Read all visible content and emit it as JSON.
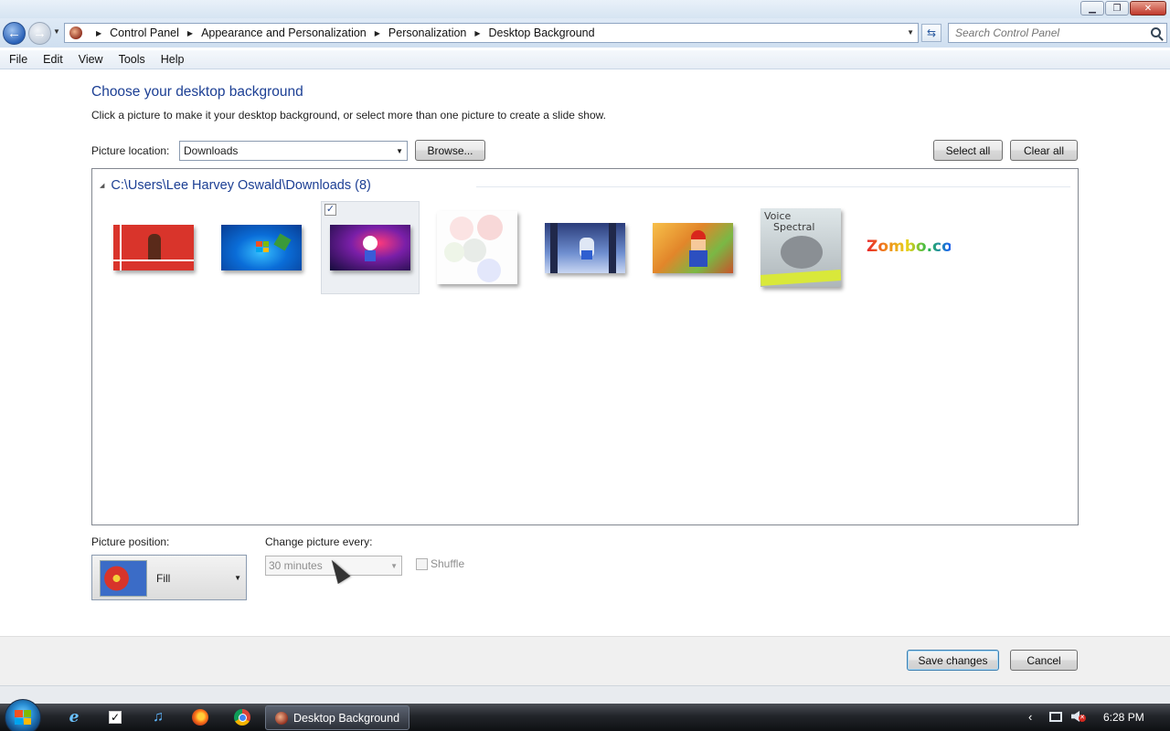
{
  "window": {
    "buttons": [
      "minimize",
      "maximize",
      "close"
    ]
  },
  "address": {
    "crumbs": [
      "Control Panel",
      "Appearance and Personalization",
      "Personalization",
      "Desktop Background"
    ],
    "search_placeholder": "Search Control Panel"
  },
  "menu": [
    "File",
    "Edit",
    "View",
    "Tools",
    "Help"
  ],
  "main": {
    "heading": "Choose your desktop background",
    "subtext": "Click a picture to make it your desktop background, or select more than one picture to create a slide show.",
    "location_label": "Picture location:",
    "location_value": "Downloads",
    "browse_label": "Browse...",
    "select_all_label": "Select all",
    "clear_all_label": "Clear all",
    "group_header": "C:\\Users\\Lee Harvey Oswald\\Downloads (8)",
    "thumbnails": [
      {
        "name": "thumbnail-red-character",
        "selected": false
      },
      {
        "name": "thumbnail-windows-blue",
        "selected": false
      },
      {
        "name": "thumbnail-bomberman",
        "selected": true
      },
      {
        "name": "thumbnail-faint-circles",
        "selected": false
      },
      {
        "name": "thumbnail-snow-scene",
        "selected": false
      },
      {
        "name": "thumbnail-mario",
        "selected": false
      },
      {
        "name": "thumbnail-voice-spectral",
        "selected": false,
        "text_top": "Voice",
        "text_bottom": "Spectral"
      },
      {
        "name": "thumbnail-zombo",
        "selected": false,
        "text": "Zombo.com"
      }
    ],
    "position_label": "Picture position:",
    "position_value": "Fill",
    "change_label": "Change picture every:",
    "change_value": "30 minutes",
    "shuffle_label": "Shuffle"
  },
  "footer": {
    "save_label": "Save changes",
    "cancel_label": "Cancel"
  },
  "taskbar": {
    "active_task": "Desktop Background",
    "clock": "6:28 PM",
    "pinned": [
      "ie-icon",
      "checklist-icon",
      "music-icon",
      "firefox-icon",
      "chrome-icon"
    ]
  },
  "colors": {
    "heading": "#1c3f94",
    "link_blue": "#1c3f94",
    "taskbar_dark": "#22252a"
  }
}
